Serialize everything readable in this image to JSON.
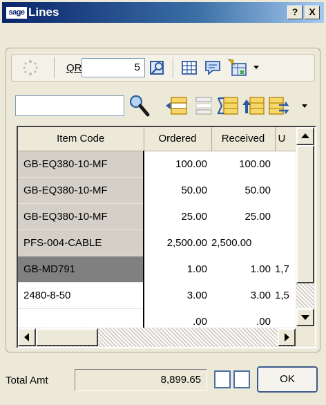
{
  "window": {
    "title": "Lines",
    "logo_text": "sage",
    "help_label": "?",
    "close_label": "X"
  },
  "toolbar": {
    "qr_label": "QR",
    "qr_value": "5",
    "icons": [
      "spinner-icon",
      "zoom-lookup-icon",
      "grid-icon",
      "comment-icon",
      "import-icon",
      "dropdown-arrow-icon",
      "search-icon",
      "insert-line-icon",
      "delete-line-icon",
      "total-line-icon",
      "move-up-icon",
      "renumber-icon",
      "overflow-arrow-icon"
    ]
  },
  "search": {
    "value": ""
  },
  "grid": {
    "columns": [
      "Item Code",
      "Ordered",
      "Received",
      "U"
    ],
    "rows": [
      {
        "code": "GB-EQ380-10-MF",
        "ordered": "100.00",
        "received": "100.00",
        "unit": ""
      },
      {
        "code": "GB-EQ380-10-MF",
        "ordered": "50.00",
        "received": "50.00",
        "unit": ""
      },
      {
        "code": "GB-EQ380-10-MF",
        "ordered": "25.00",
        "received": "25.00",
        "unit": ""
      },
      {
        "code": "PFS-004-CABLE",
        "ordered": "2,500.00",
        "received": "2,500.00",
        "unit": ""
      },
      {
        "code": "GB-MD791",
        "ordered": "1.00",
        "received": "1.00",
        "unit": "1,7"
      },
      {
        "code": "2480-8-50",
        "ordered": "3.00",
        "received": "3.00",
        "unit": "1,5"
      },
      {
        "code": "",
        "ordered": ".00",
        "received": ".00",
        "unit": ""
      }
    ],
    "selected_row": 4
  },
  "footer": {
    "total_label": "Total Amt",
    "total_value": "8,899.65",
    "ok_label": "OK"
  },
  "colors": {
    "title_bar": "#0a246a",
    "window_bg": "#ece9d8",
    "selected_cell": "#808080"
  }
}
